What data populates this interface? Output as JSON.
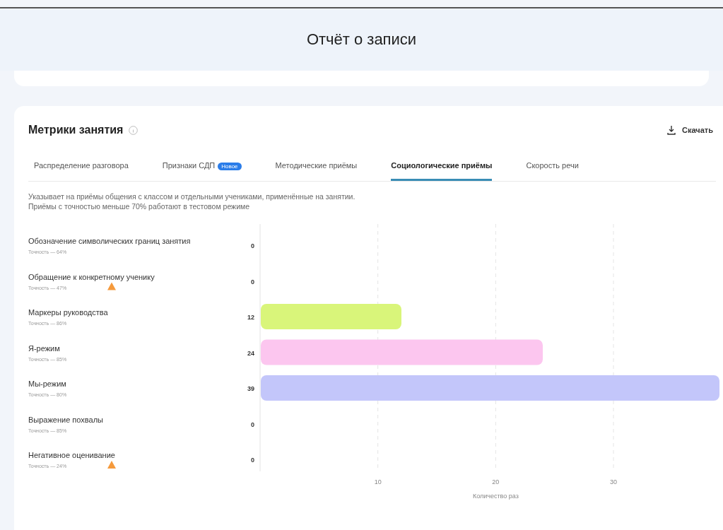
{
  "page_title": "Отчёт о записи",
  "card": {
    "title": "Метрики занятия",
    "download": "Скачать",
    "tabs": [
      {
        "label": "Распределение разговора",
        "selected": false
      },
      {
        "label": "Признаки СДП",
        "badge": "Новое",
        "selected": false
      },
      {
        "label": "Методические приёмы",
        "selected": false
      },
      {
        "label": "Социологические приёмы",
        "selected": true
      },
      {
        "label": "Скорость речи",
        "selected": false
      }
    ],
    "description": [
      "Указывает на приёмы общения с классом и отдельными учениками, применённые на занятии.",
      "Приёмы с точностью меньше 70% работают в тестовом режиме"
    ],
    "row_notes": [
      {
        "accuracy": "Точность — 64%",
        "warning": false
      },
      {
        "accuracy": "Точность — 47%",
        "warning": true
      },
      {
        "accuracy": "Точность — 86%",
        "warning": false,
        "color": "#d9f57a"
      },
      {
        "accuracy": "Точность — 85%",
        "warning": false,
        "color": "#fcc6ef"
      },
      {
        "accuracy": "Точность — 80%",
        "warning": false,
        "color": "#c3c6fa"
      },
      {
        "accuracy": "Точность — 85%",
        "warning": false
      },
      {
        "accuracy": "Точность — 24%",
        "warning": true
      }
    ],
    "chart_data": {
      "type": "bar",
      "orientation": "horizontal",
      "xlabel": "Количество раз",
      "categories": [
        "Обозначение символических границ занятия",
        "Обращение к конкретному ученику",
        "Маркеры руководства",
        "Я-режим",
        "Мы-режим",
        "Выражение похвалы",
        "Негативное оценивание"
      ],
      "values": [
        0,
        0,
        12,
        24,
        39,
        0,
        0
      ],
      "xlim": [
        0,
        39
      ],
      "xticks": [
        10,
        20,
        30
      ],
      "data_labels": true,
      "grid": true
    }
  }
}
